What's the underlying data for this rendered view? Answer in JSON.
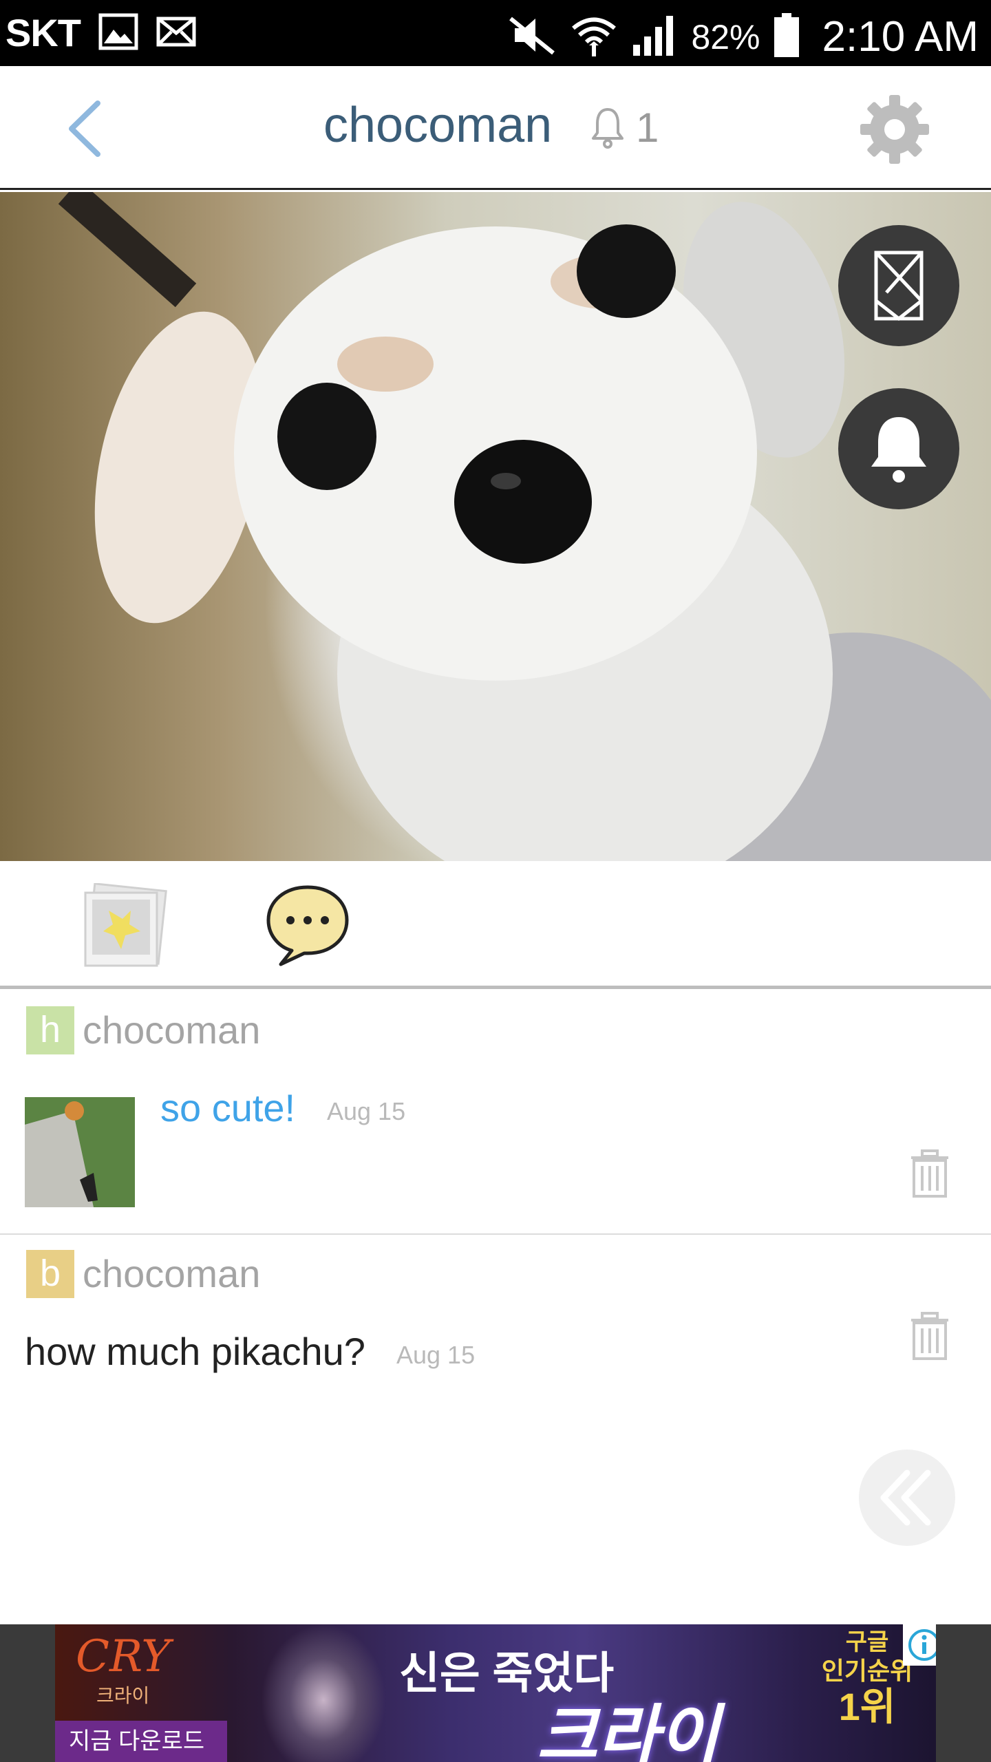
{
  "status_bar": {
    "carrier": "SKT",
    "battery": "82%",
    "time": "2:10 AM"
  },
  "header": {
    "title": "chocoman",
    "notification_count": "1"
  },
  "comments": [
    {
      "avatar_letter": "h",
      "username": "chocoman",
      "message": "so cute!",
      "date": "Aug 15"
    },
    {
      "avatar_letter": "b",
      "username": "chocoman",
      "message": "how much pikachu?",
      "date": "Aug 15"
    }
  ],
  "ad": {
    "brand": "CRY",
    "brand_sub": "크라이",
    "headline": "신은 죽었다",
    "title": "크라이",
    "download": "지금 다운로드",
    "rank_line1": "구글",
    "rank_line2": "인기순위",
    "rank_line3": "1위"
  },
  "colors": {
    "header_title": "#3b5d78",
    "link_message": "#3fa3e8",
    "back_arrow": "#8fb8de"
  }
}
